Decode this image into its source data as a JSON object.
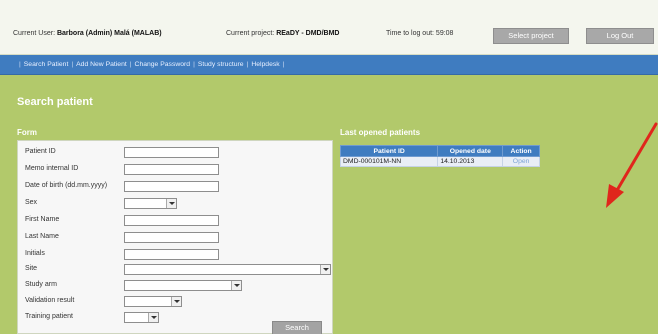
{
  "header": {
    "current_user_label": "Current User:",
    "current_user_value": "Barbora (Admin) Malá (MALAB)",
    "current_project_label": "Current project:",
    "current_project_value": "REaDY - DMD/BMD",
    "logout_timer": "Time to log out: 59:08",
    "select_project_label": "Select project",
    "logout_label": "Log Out"
  },
  "nav": {
    "items": [
      "Search Patient",
      "Add New Patient",
      "Change Password",
      "Study structure",
      "Helpdesk"
    ]
  },
  "page": {
    "title": "Search patient",
    "form_label": "Form",
    "last_opened_label": "Last opened patients"
  },
  "form": {
    "fields": [
      {
        "label": "Patient ID"
      },
      {
        "label": "Memo internal ID"
      },
      {
        "label": "Date of birth (dd.mm.yyyy)"
      },
      {
        "label": "Sex"
      },
      {
        "label": "First Name"
      },
      {
        "label": "Last Name"
      },
      {
        "label": "Initials"
      },
      {
        "label": "Site"
      },
      {
        "label": "Study arm"
      },
      {
        "label": "Validation result"
      },
      {
        "label": "Training patient"
      }
    ],
    "search_label": "Search"
  },
  "last_opened": {
    "headers": [
      "Patient ID",
      "Opened date",
      "Action"
    ],
    "rows": [
      {
        "patient_id": "DMD-000101M-NN",
        "opened_date": "14.10.2013",
        "action": "Open"
      }
    ]
  },
  "colors": {
    "page_background": "#b2c96b",
    "nav_blue": "#3f7cc0",
    "annotation_arrow": "#e0261c"
  }
}
